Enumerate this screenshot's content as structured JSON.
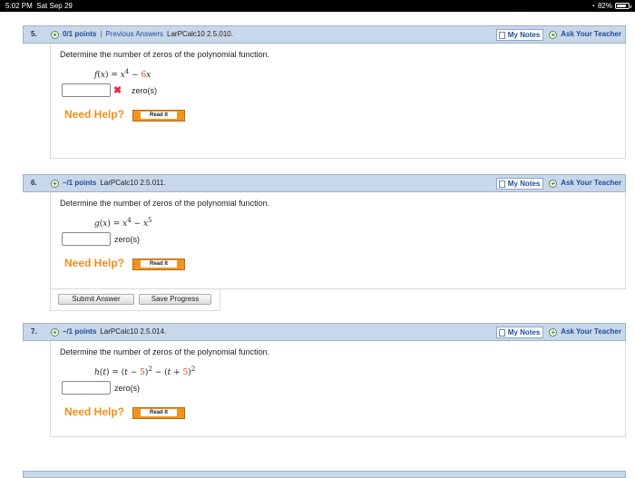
{
  "status_bar": {
    "time": "5:02 PM",
    "date": "Sat Sep 29",
    "battery": "82%",
    "battery_level": 0.82
  },
  "questions": [
    {
      "number": "5.",
      "points": "0/1 points",
      "separator": "|",
      "previous_answers": "Previous Answers",
      "source": "LarPCalc10 2.5.010.",
      "my_notes": "My Notes",
      "ask_teacher": "Ask Your Teacher",
      "prompt": "Determine the number of zeros of the polynomial function.",
      "formula": {
        "fn": "f",
        "var": "x",
        "rest_a": " = ",
        "term1": "x",
        "exp1": "4",
        "op": " − ",
        "coef": "6",
        "term2": "x"
      },
      "answer_value": "",
      "answer_unit": "zero(s)",
      "incorrect_mark": "✖",
      "need_help": "Need Help?",
      "read_it": "Read It"
    },
    {
      "number": "6.",
      "points": "–/1 points",
      "source": "LarPCalc10 2.5.011.",
      "my_notes": "My Notes",
      "ask_teacher": "Ask Your Teacher",
      "prompt": "Determine the number of zeros of the polynomial function.",
      "formula": {
        "fn": "g",
        "var": "x",
        "term1": "x",
        "exp1": "4",
        "op": " − ",
        "term2": "x",
        "exp2": "5"
      },
      "answer_value": "",
      "answer_unit": "zero(s)",
      "need_help": "Need Help?",
      "read_it": "Read It",
      "submit_answer": "Submit Answer",
      "save_progress": "Save Progress"
    },
    {
      "number": "7.",
      "points": "–/1 points",
      "source": "LarPCalc10 2.5.014.",
      "my_notes": "My Notes",
      "ask_teacher": "Ask Your Teacher",
      "prompt": "Determine the number of zeros of the polynomial function.",
      "formula": {
        "fn": "h",
        "var": "t",
        "c1": "5",
        "c2": "5",
        "exp": "2"
      },
      "answer_value": "",
      "answer_unit": "zero(s)",
      "need_help": "Need Help?",
      "read_it": "Read It"
    }
  ],
  "colors": {
    "header_bg": "#c8d7e9",
    "link_blue": "#1f4d9c",
    "need_help_orange": "#f0901a",
    "read_it_orange": "#f19320",
    "incorrect_red": "#e0293a",
    "coef_red": "#d13d1a"
  }
}
